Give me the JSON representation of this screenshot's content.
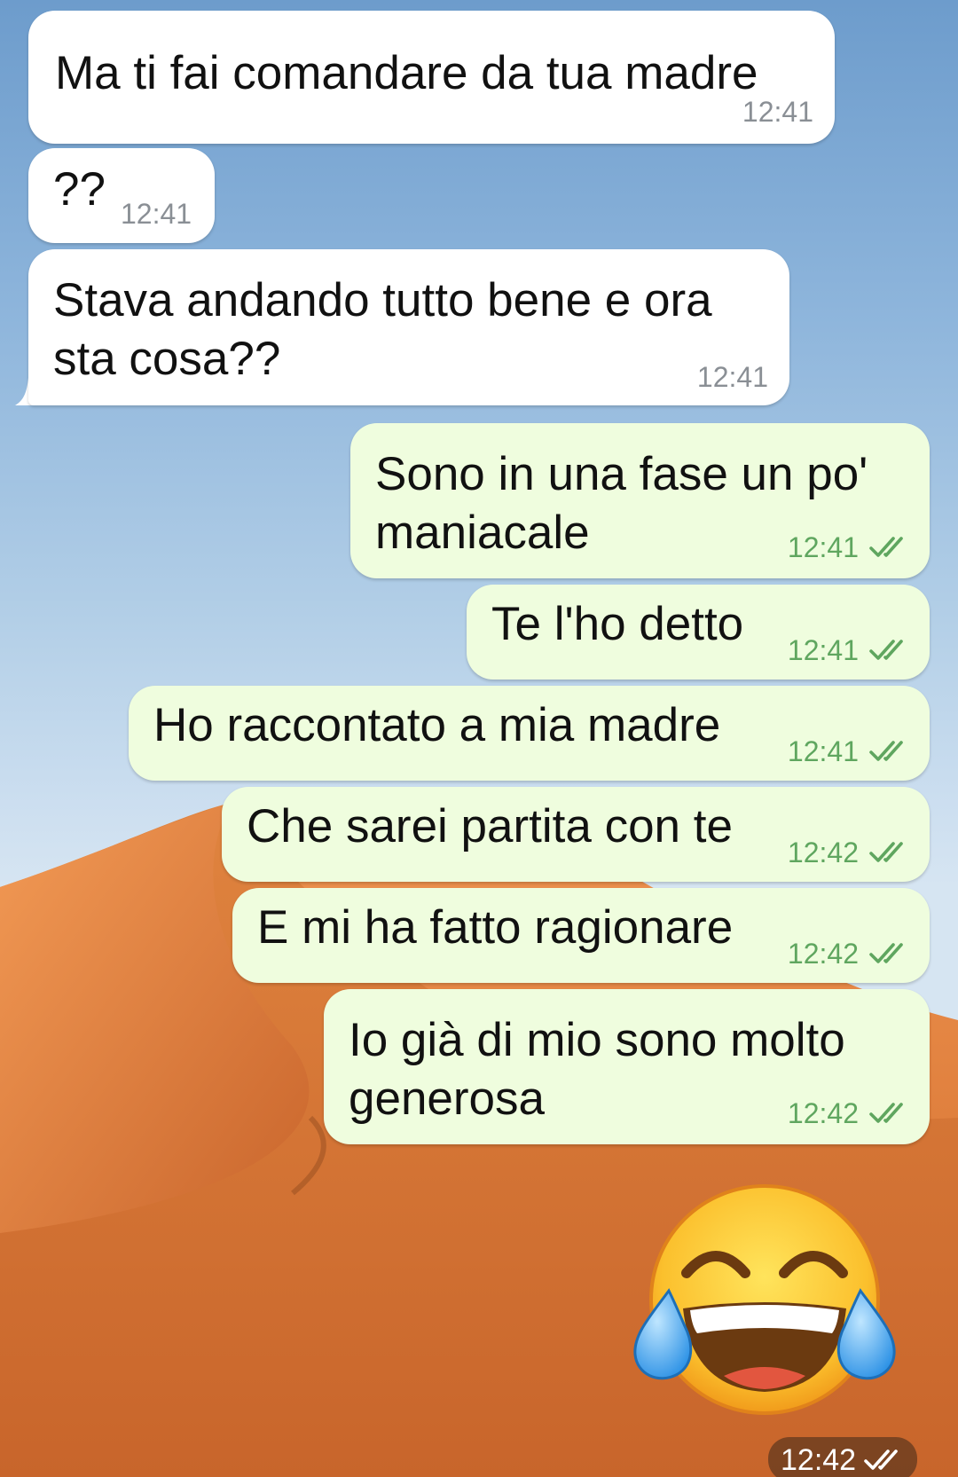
{
  "colors": {
    "incoming_bubble": "#ffffff",
    "outgoing_bubble": "#effdde",
    "incoming_time": "#8a8f95",
    "outgoing_time": "#5fa65f",
    "sky": "#8fb6dc",
    "dune": "#e07a3a"
  },
  "messages": [
    {
      "direction": "incoming",
      "text": "Ma ti fai comandare da tua madre",
      "time": "12:41"
    },
    {
      "direction": "incoming",
      "text": "??",
      "time": "12:41"
    },
    {
      "direction": "incoming",
      "text": "Stava andando tutto bene e ora\nsta cosa??",
      "time": "12:41"
    },
    {
      "direction": "outgoing",
      "text": "Sono in una fase un po'\nmaniacale",
      "time": "12:41",
      "status": "read"
    },
    {
      "direction": "outgoing",
      "text": "Te l'ho detto",
      "time": "12:41",
      "status": "read"
    },
    {
      "direction": "outgoing",
      "text": "Ho raccontato a mia madre",
      "time": "12:41",
      "status": "read"
    },
    {
      "direction": "outgoing",
      "text": "Che sarei partita con te",
      "time": "12:42",
      "status": "read"
    },
    {
      "direction": "outgoing",
      "text": "E mi ha fatto ragionare",
      "time": "12:42",
      "status": "read"
    },
    {
      "direction": "outgoing",
      "text": "Io già di mio sono molto\ngenerosa",
      "time": "12:42",
      "status": "read"
    }
  ],
  "sticker": {
    "icon": "face-with-tears-of-joy-icon",
    "time": "12:42",
    "status": "read"
  }
}
